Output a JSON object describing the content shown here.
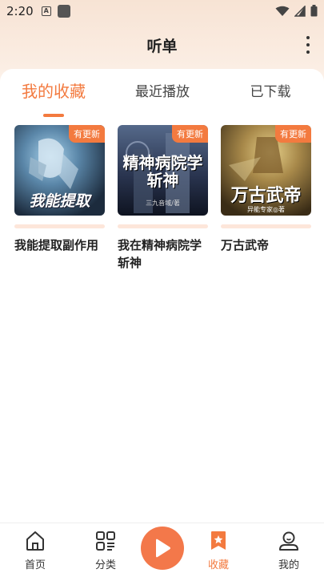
{
  "status_bar": {
    "time": "2:20",
    "notification_letter": "A"
  },
  "header": {
    "title": "听单"
  },
  "tabs": [
    {
      "label": "我的收藏",
      "active": true
    },
    {
      "label": "最近播放",
      "active": false
    },
    {
      "label": "已下载",
      "active": false
    }
  ],
  "books": [
    {
      "title": "我能提取副作用",
      "badge": "有更新",
      "cover_text": "我能提取",
      "cover_colors": [
        "#7aa9c7",
        "#1a2a3a"
      ]
    },
    {
      "title": "我在精神病院学斩神",
      "badge": "有更新",
      "cover_text": "精神病院学斩神",
      "cover_sub": "三九音域/著",
      "cover_colors": [
        "#3a4d6a",
        "#0f1522"
      ]
    },
    {
      "title": "万古武帝",
      "badge": "有更新",
      "cover_text": "万古武帝",
      "cover_sub": "异能专家◎著",
      "cover_colors": [
        "#b7a46a",
        "#3b2d16"
      ]
    }
  ],
  "bottom_nav": [
    {
      "label": "首页",
      "icon": "home-icon",
      "active": false
    },
    {
      "label": "分类",
      "icon": "category-icon",
      "active": false
    },
    {
      "label": "收藏",
      "icon": "bookmark-star-icon",
      "active": true
    },
    {
      "label": "我的",
      "icon": "profile-icon",
      "active": false
    }
  ],
  "colors": {
    "accent": "#f37a3f",
    "badge_bg": "#f37a3f"
  }
}
